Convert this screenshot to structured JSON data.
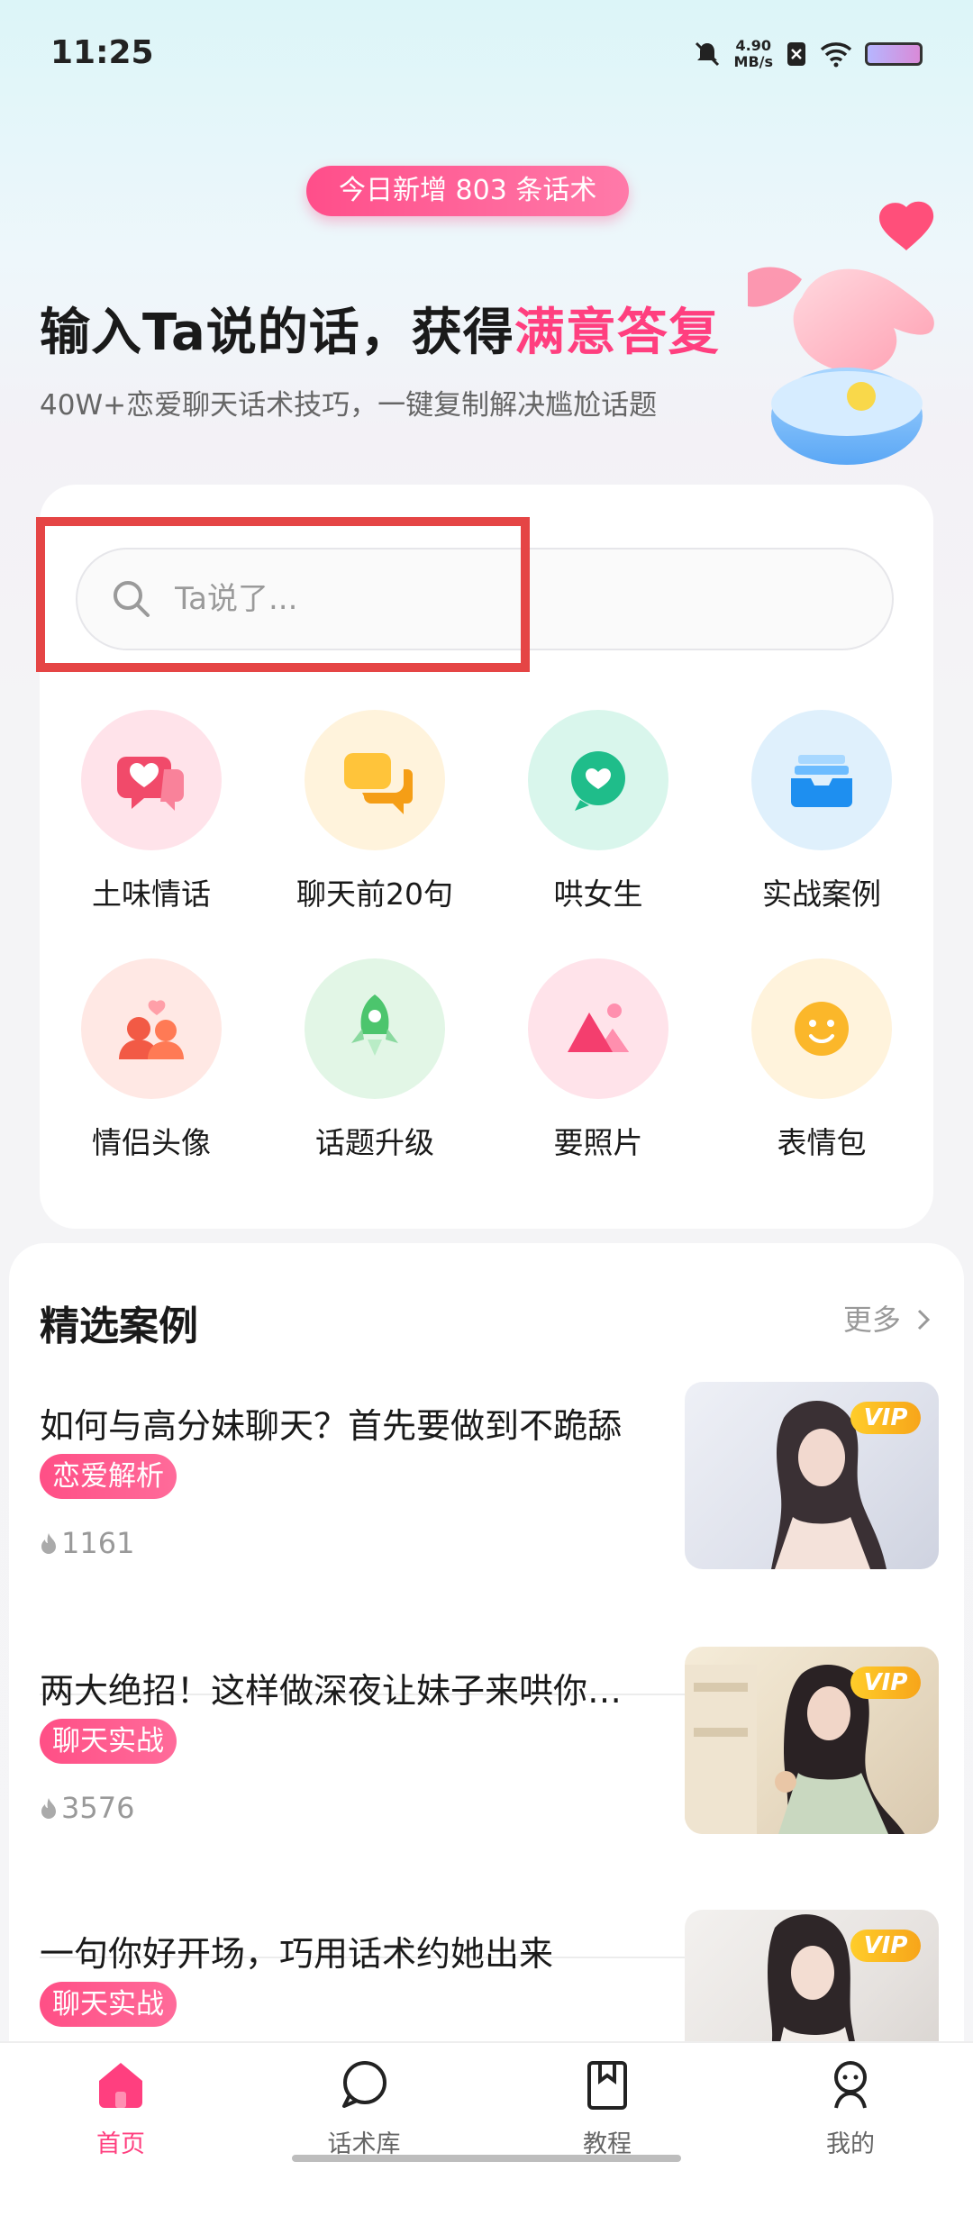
{
  "status": {
    "time": "11:25",
    "net_speed_value": "4.90",
    "net_speed_unit": "MB/s"
  },
  "hero": {
    "pill": "今日新增 803 条话术",
    "title_main": "输入Ta说的话，获得",
    "title_accent": "满意答复",
    "subtitle": "40W+恋爱聊天话术技巧，一键复制解决尴尬话题"
  },
  "search": {
    "placeholder": "Ta说了..."
  },
  "grid": [
    {
      "label": "土味情话",
      "icon": "heart-chat-icon"
    },
    {
      "label": "聊天前20句",
      "icon": "chat-bubbles-icon"
    },
    {
      "label": "哄女生",
      "icon": "heart-bubble-icon"
    },
    {
      "label": "实战案例",
      "icon": "inbox-icon"
    },
    {
      "label": "情侣头像",
      "icon": "couple-icon"
    },
    {
      "label": "话题升级",
      "icon": "rocket-icon"
    },
    {
      "label": "要照片",
      "icon": "picture-icon"
    },
    {
      "label": "表情包",
      "icon": "smiley-icon"
    }
  ],
  "featured": {
    "title": "精选案例",
    "more": "更多",
    "cases": [
      {
        "title": "如何与高分妹聊天？首先要做到不跪舔",
        "tag": "恋爱解析",
        "views": "1161",
        "vip": "VIP"
      },
      {
        "title": "两大绝招！这样做深夜让妹子来哄你…",
        "tag": "聊天实战",
        "views": "3576",
        "vip": "VIP"
      },
      {
        "title": "一句你好开场，巧用话术约她出来",
        "tag": "聊天实战",
        "views": "",
        "vip": "VIP"
      }
    ]
  },
  "tabs": [
    {
      "label": "首页",
      "icon": "home-icon",
      "active": true
    },
    {
      "label": "话术库",
      "icon": "chat-icon",
      "active": false
    },
    {
      "label": "教程",
      "icon": "bookmark-book-icon",
      "active": false
    },
    {
      "label": "我的",
      "icon": "person-icon",
      "active": false
    }
  ],
  "colors": {
    "accent": "#ff3f7f",
    "vip": "#f9b81f",
    "highlight_box": "#e54545"
  }
}
